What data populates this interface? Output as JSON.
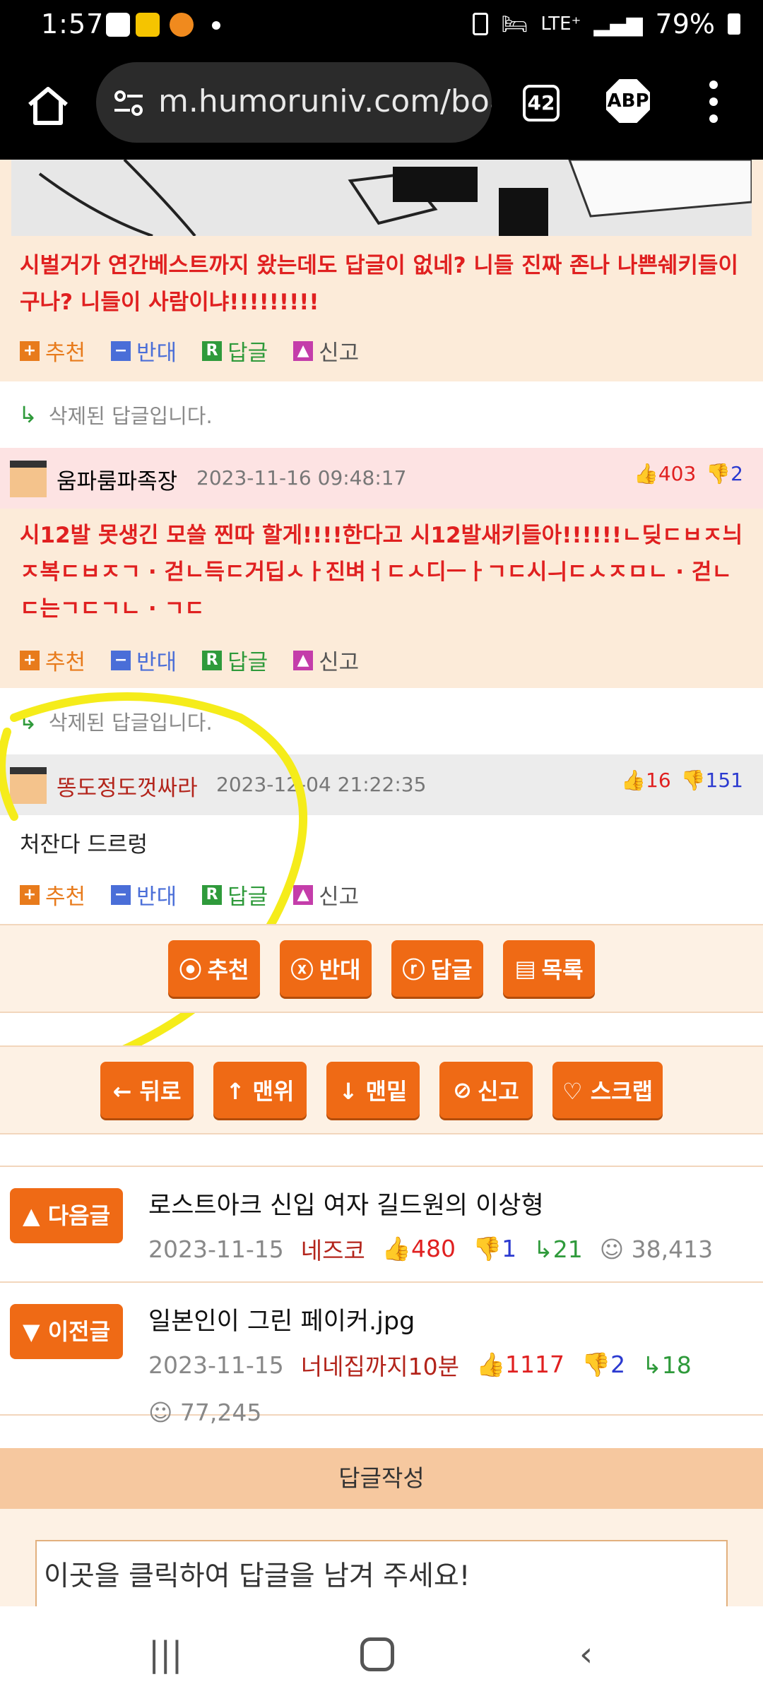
{
  "status": {
    "time": "1:57",
    "network": "LTE⁺",
    "battery": "79%"
  },
  "browser": {
    "url": "m.humoruniv.com/boa",
    "tab_count": "42",
    "adblock": "ABP"
  },
  "posts": [
    {
      "id": "post1",
      "text": "시벌거가 연간베스트까지 왔는데도 답글이 없네? 니들 진짜 존나 나쁜쉐키들이구나? 니들이 사람이냐!!!!!!!!!"
    }
  ],
  "deleted_label": "삭제된 답글입니다.",
  "comment2": {
    "nickname": "움파룸파족장",
    "date": "2023-11-16 09:48:17",
    "up": "403",
    "down": "2",
    "text": "시12발 못생긴 모쓸 찐따 할게!!!!한다고 시12발새키들아!!!!!!ㄴ딪ㄷㅂㅈ늬ㅈ복ㄷㅂㅈㄱ · 걷ㄴ득ㄷ거딥ㅅㅏ진벼ㅓㄷㅅ디ㅡㅏㄱㄷ시ㅢㄷㅅㅈㅁㄴ · 걷ㄴㄷ는ㄱㄷㄱㄴ · ㄱㄷ"
  },
  "comment3": {
    "nickname": "똥도정도껏싸라",
    "date": "2023-12-04 21:22:35",
    "up": "16",
    "down": "151",
    "text": "처잔다 드르렁"
  },
  "actions": {
    "recommend": "추천",
    "oppose": "반대",
    "reply": "답글",
    "report": "신고"
  },
  "action_bar": {
    "recommend": "추천",
    "oppose": "반대",
    "reply": "답글",
    "list": "목록"
  },
  "nav_bar": {
    "back": "← 뒤로",
    "top": "↑ 맨위",
    "bottom": "↓ 맨밑",
    "report": "신고",
    "scrap": "♡ 스크랩"
  },
  "next_post": {
    "label": "▲ 다음글",
    "title": "로스트아크 신입 여자 길드원의 이상형",
    "date": "2023-11-15",
    "user": "네즈코",
    "up": "480",
    "down": "1",
    "replies": "21",
    "views": "38,413"
  },
  "prev_post": {
    "label": "▼ 이전글",
    "title": "일본인이 그린 페이커.jpg",
    "date": "2023-11-15",
    "user": "너네집까지10분",
    "up": "1117",
    "down": "2",
    "replies": "18",
    "views": "77,245"
  },
  "reply_section": {
    "header": "답글작성",
    "placeholder": "이곳을 클릭하여 답글을 남겨 주세요!"
  },
  "colors": {
    "accent": "#ef6a15",
    "highlight": "#f5ec1a",
    "comment_bg": "#fcebd9"
  }
}
